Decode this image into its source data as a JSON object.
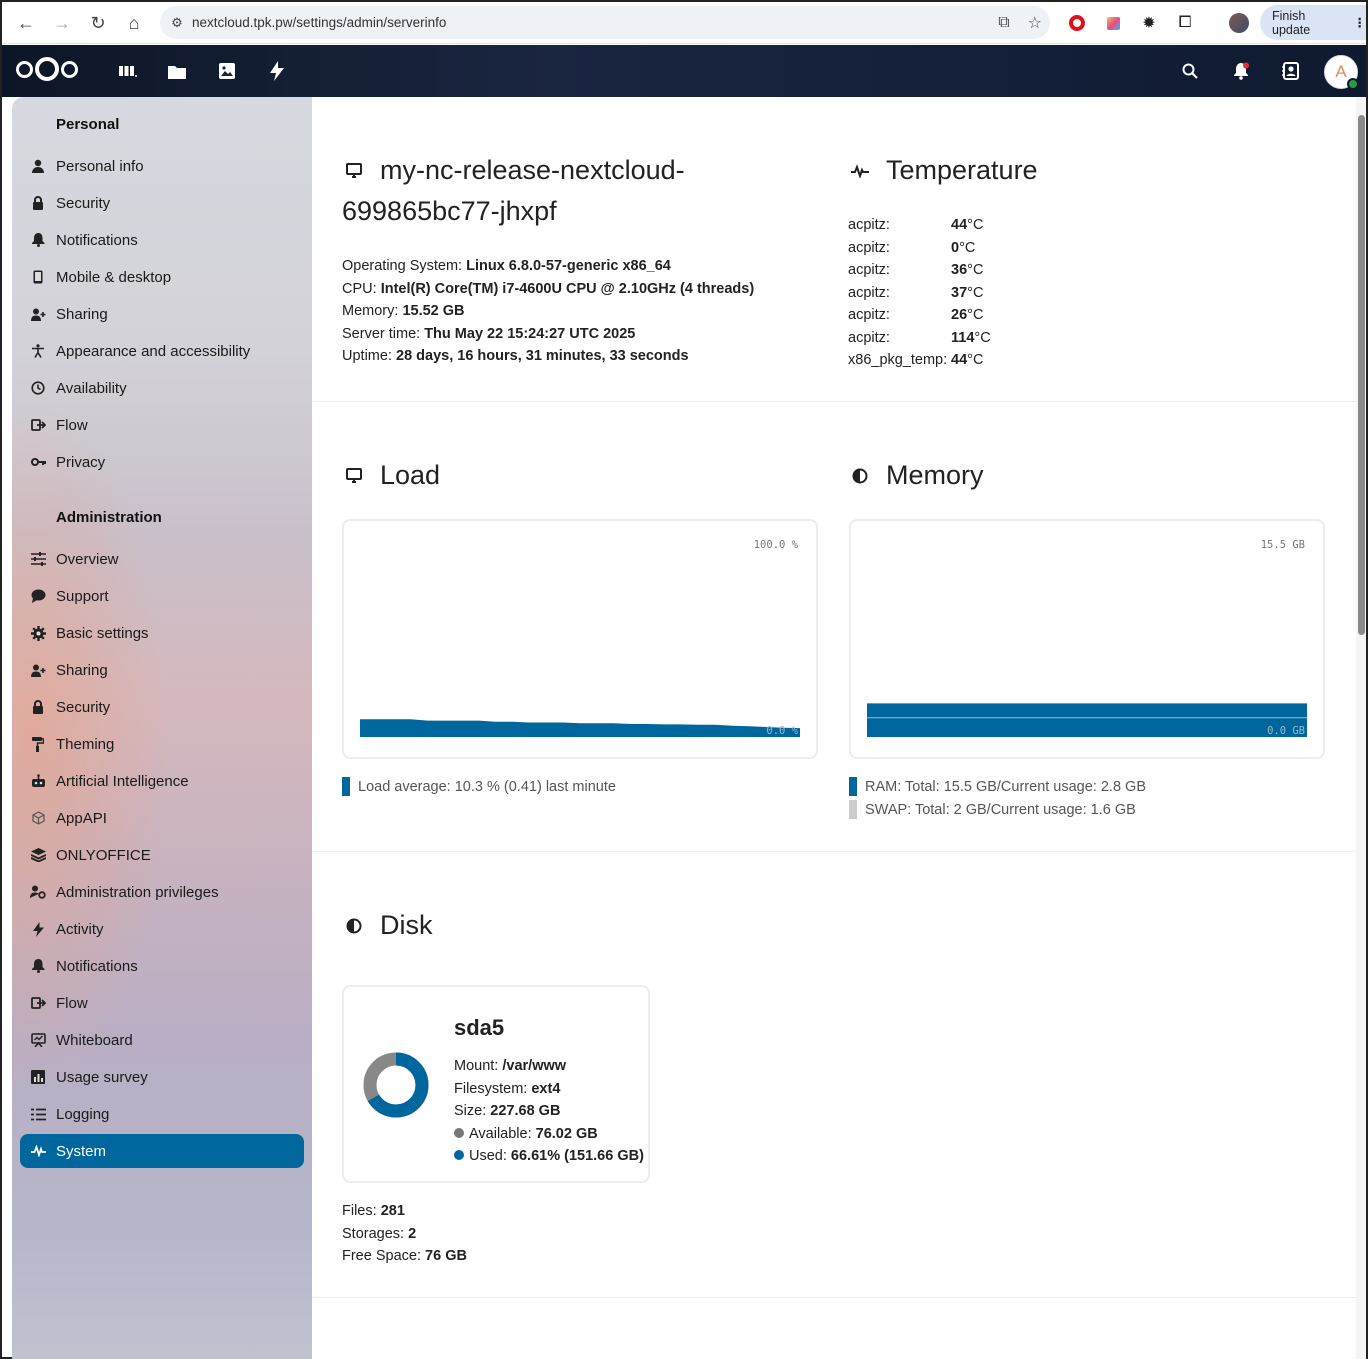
{
  "browser": {
    "url": "nextcloud.tpk.pw/settings/admin/serverinfo",
    "finish_update": "Finish update"
  },
  "header": {
    "avatar_letter": "A"
  },
  "sidebar": {
    "personal_title": "Personal",
    "personal_items": [
      {
        "label": "Personal info",
        "icon": "person-icon"
      },
      {
        "label": "Security",
        "icon": "lock-icon"
      },
      {
        "label": "Notifications",
        "icon": "bell-icon"
      },
      {
        "label": "Mobile & desktop",
        "icon": "phone-icon"
      },
      {
        "label": "Sharing",
        "icon": "share-icon"
      },
      {
        "label": "Appearance and accessibility",
        "icon": "accessibility-icon"
      },
      {
        "label": "Availability",
        "icon": "clock-icon"
      },
      {
        "label": "Flow",
        "icon": "flow-icon"
      },
      {
        "label": "Privacy",
        "icon": "key-icon"
      }
    ],
    "admin_title": "Administration",
    "admin_items": [
      {
        "label": "Overview",
        "icon": "sliders-icon"
      },
      {
        "label": "Support",
        "icon": "chat-icon"
      },
      {
        "label": "Basic settings",
        "icon": "gear-icon"
      },
      {
        "label": "Sharing",
        "icon": "share-icon"
      },
      {
        "label": "Security",
        "icon": "lock-icon"
      },
      {
        "label": "Theming",
        "icon": "paint-roller-icon"
      },
      {
        "label": "Artificial Intelligence",
        "icon": "robot-icon"
      },
      {
        "label": "AppAPI",
        "icon": "cube-icon"
      },
      {
        "label": "ONLYOFFICE",
        "icon": "layers-icon"
      },
      {
        "label": "Administration privileges",
        "icon": "user-cog-icon"
      },
      {
        "label": "Activity",
        "icon": "lightning-icon"
      },
      {
        "label": "Notifications",
        "icon": "bell-icon"
      },
      {
        "label": "Flow",
        "icon": "flow-icon"
      },
      {
        "label": "Whiteboard",
        "icon": "whiteboard-icon"
      },
      {
        "label": "Usage survey",
        "icon": "chart-icon"
      },
      {
        "label": "Logging",
        "icon": "list-icon"
      },
      {
        "label": "System",
        "icon": "pulse-icon",
        "active": true
      }
    ]
  },
  "server": {
    "hostname_line1": "my-nc-release-nextcloud-",
    "hostname_line2": "699865bc77-jhxpf",
    "os_label": "Operating System:",
    "os_value": "Linux 6.8.0-57-generic x86_64",
    "cpu_label": "CPU:",
    "cpu_value": "Intel(R) Core(TM) i7-4600U CPU @ 2.10GHz (4 threads)",
    "memory_label": "Memory:",
    "memory_value": "15.52 GB",
    "time_label": "Server time:",
    "time_value": "Thu May 22 15:24:27 UTC 2025",
    "uptime_label": "Uptime:",
    "uptime_value": "28 days, 16 hours, 31 minutes, 33 seconds"
  },
  "temperature": {
    "title": "Temperature",
    "rows": [
      {
        "k": "acpitz:",
        "v": "44",
        "u": "°C"
      },
      {
        "k": "acpitz:",
        "v": "0",
        "u": "°C"
      },
      {
        "k": "acpitz:",
        "v": "36",
        "u": "°C"
      },
      {
        "k": "acpitz:",
        "v": "37",
        "u": "°C"
      },
      {
        "k": "acpitz:",
        "v": "26",
        "u": "°C"
      },
      {
        "k": "acpitz:",
        "v": "114",
        "u": "°C"
      },
      {
        "k": "x86_pkg_temp:",
        "v": "44",
        "u": "°C"
      }
    ]
  },
  "load": {
    "title": "Load",
    "max_label": "100.0 %",
    "min_label": "0.0 %",
    "legend": "Load average: 10.3 % (0.41) last minute",
    "color": "#00679e"
  },
  "memory": {
    "title": "Memory",
    "max_label": "15.5 GB",
    "min_label": "0.0 GB",
    "ram_legend": "RAM: Total: 15.5 GB/Current usage: 2.8 GB",
    "swap_legend": "SWAP: Total: 2 GB/Current usage: 1.6 GB",
    "ram_color": "#00679e",
    "swap_color": "#cccccc"
  },
  "disk": {
    "title": "Disk",
    "name": "sda5",
    "mount_label": "Mount:",
    "mount_value": "/var/www",
    "fs_label": "Filesystem:",
    "fs_value": "ext4",
    "size_label": "Size:",
    "size_value": "227.68 GB",
    "available_label": "Available:",
    "available_value": "76.02 GB",
    "used_label": "Used:",
    "used_value": "66.61% (151.66 GB)",
    "used_fraction": 0.6661,
    "files_label": "Files:",
    "files_value": "281",
    "storages_label": "Storages:",
    "storages_value": "2",
    "free_label": "Free Space:",
    "free_value": "76 GB"
  },
  "chart_data": [
    {
      "type": "area",
      "title": "Load",
      "ylim": [
        0,
        100
      ],
      "series": [
        {
          "values": [
            9.5,
            9.5,
            9.5,
            9.5,
            8.8,
            8.8,
            8.8,
            8.8,
            8.2,
            8.2,
            7.8,
            7.8,
            7.8,
            7.4,
            7.4,
            7.4,
            7.0,
            7.0,
            6.8,
            6.8,
            6.6,
            6.6,
            6.0,
            5.8,
            5.4,
            5.0,
            4.8
          ]
        }
      ]
    },
    {
      "type": "area",
      "title": "Memory",
      "ylim": [
        0,
        15.5
      ],
      "series": [
        {
          "name": "RAM",
          "values": [
            2.8,
            2.8,
            2.8,
            2.8,
            2.8,
            2.8,
            2.8,
            2.8,
            2.8,
            2.8
          ]
        },
        {
          "name": "SWAP",
          "values": [
            1.6,
            1.6,
            1.6,
            1.6,
            1.6,
            1.6,
            1.6,
            1.6,
            1.6,
            1.6
          ]
        }
      ]
    }
  ]
}
